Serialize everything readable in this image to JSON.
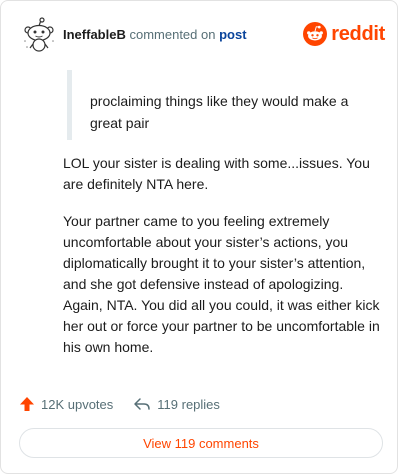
{
  "header": {
    "username": "IneffableB",
    "commented_text": "commented on",
    "post_link": "post",
    "brand": "reddit",
    "brand_color": "#ff4500",
    "avatar_icon": "snoo-avatar-icon",
    "logo_icon": "reddit-logo-icon"
  },
  "quote": {
    "text": "proclaiming things like they would make a great pair"
  },
  "body": {
    "paragraphs": [
      "LOL your sister is dealing with some...issues. You are definitely NTA here.",
      "Your partner came to you feeling extremely uncomfortable about your sister’s actions, you diplomatically brought it to your sister’s attention, and she got defensive instead of apologizing. Again, NTA. You did all you could, it was either kick her out or force your partner to be uncomfortable in his own home."
    ]
  },
  "actions": {
    "upvotes": "12K upvotes",
    "replies": "119 replies",
    "upvote_icon": "upvote-arrow-icon",
    "reply_icon": "reply-arrow-icon"
  },
  "footer": {
    "view_comments": "View 119 comments"
  }
}
